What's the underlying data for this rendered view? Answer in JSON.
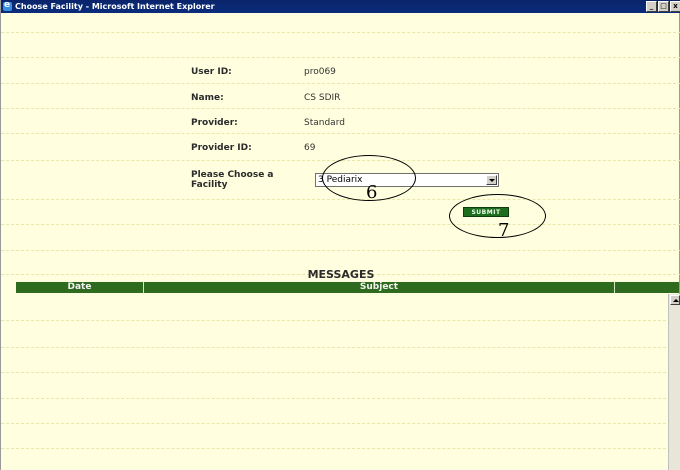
{
  "window": {
    "title": "Choose Facility - Microsoft Internet Explorer",
    "controls": [
      "_",
      "□",
      "x"
    ]
  },
  "user_info": {
    "user_id_label": "User ID:",
    "user_id_value": "pro069",
    "name_label": "Name:",
    "name_value": "CS SDIR",
    "provider_label": "Provider:",
    "provider_value": "Standard",
    "provider_id_label": "Provider ID:",
    "provider_id_value": "69"
  },
  "facility": {
    "label": "Please Choose a Facility",
    "selected": "3 Pediarix"
  },
  "submit": {
    "label": "SUBMIT"
  },
  "callouts": [
    "6",
    "7"
  ],
  "messages": {
    "title": "MESSAGES",
    "columns": [
      "Date",
      "Subject"
    ],
    "rows": []
  },
  "colors": {
    "background": "#ffffe0",
    "header_green": "#2e6b1e",
    "titlebar": "#0a246a"
  }
}
